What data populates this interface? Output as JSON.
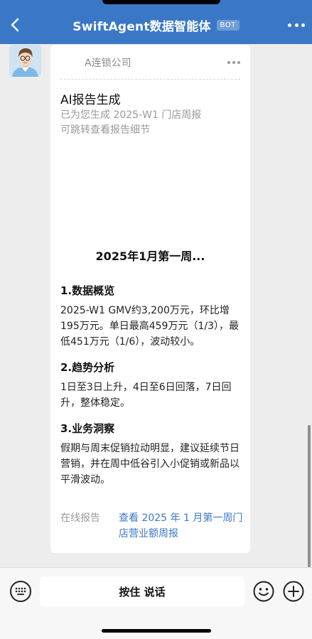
{
  "header": {
    "title": "SwiftAgent数据智能体",
    "badge": "BOT",
    "back_icon": "chevron-left-icon",
    "more_icon": "more-icon",
    "color": "#3a78c7"
  },
  "card": {
    "company": "A连锁公司",
    "report_title": "AI报告生成",
    "report_sub_line1": "已为您生成 2025-W1 门店周报",
    "report_sub_line2": "可跳转查看报告细节",
    "preview_title": "2025年1月第一周...",
    "sections": [
      {
        "heading": "1.数据概览",
        "body": "2025-W1 GMV约3,200万元，环比增195万元。单日最高459万元（1/3），最低451万元（1/6），波动较小。"
      },
      {
        "heading": "2.趋势分析",
        "body": "1日至3日上升，4日至6日回落，7日回升，整体稳定。"
      },
      {
        "heading": "3.业务洞察",
        "body": "假期与周末促销拉动明显，建议延续节日营销，并在周中低谷引入小促销或新品以平滑波动。"
      }
    ],
    "online_label": "在线报告",
    "report_link": "查看 2025 年 1 月第一周门店营业额周报",
    "link_color": "#3d78c5"
  },
  "input_bar": {
    "talk_label": "按住 说话",
    "keyboard_icon": "keyboard-icon",
    "emoji_icon": "emoji-icon",
    "plus_icon": "plus-icon"
  }
}
